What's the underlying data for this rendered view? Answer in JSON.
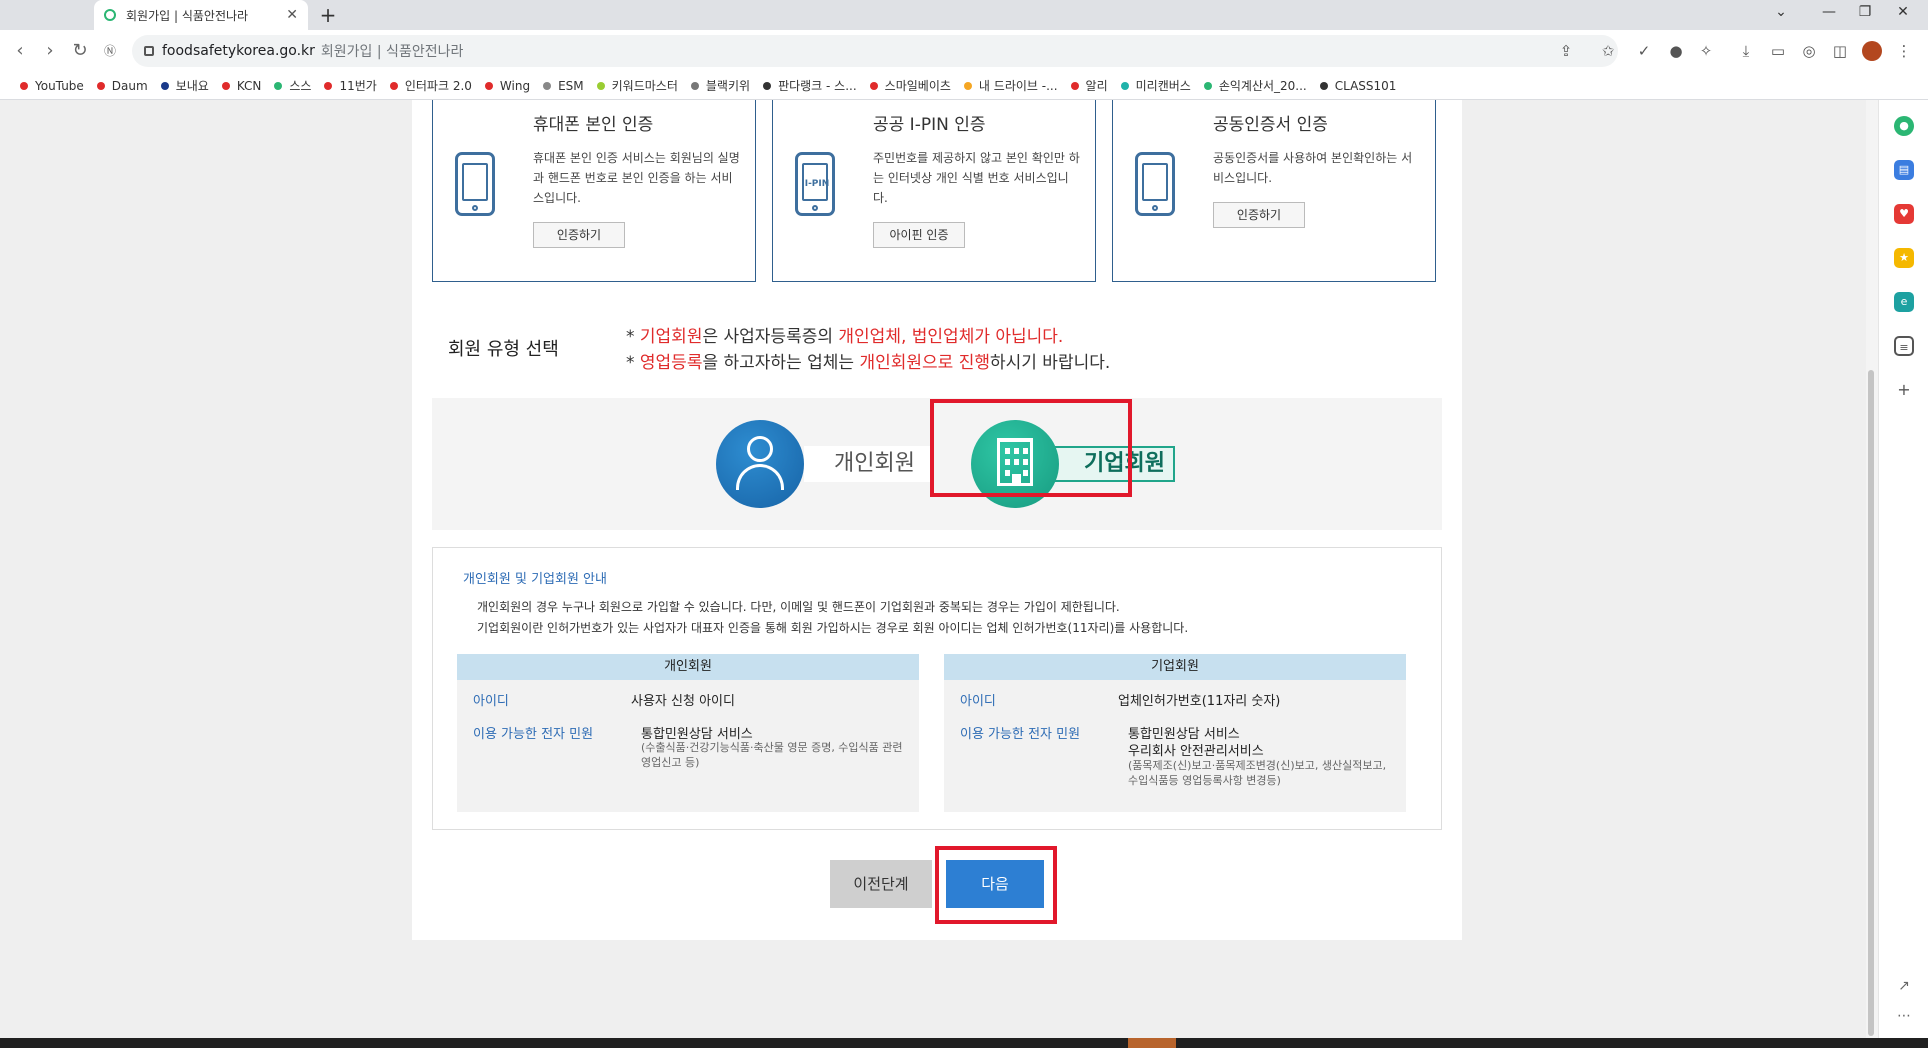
{
  "browser": {
    "tab_title": "회원가입 | 식품안전나라",
    "tab_close": "✕",
    "new_tab": "+",
    "window_controls": [
      "⌄",
      "—",
      "❐",
      "✕"
    ],
    "url_domain": "foodsafetykorea.go.kr",
    "url_path": "회원가입 | 식품안전나라",
    "bookmarks": [
      {
        "label": "YouTube",
        "color": "#e02b2b"
      },
      {
        "label": "Daum",
        "color": "#e02b2b"
      },
      {
        "label": "보내요",
        "color": "#1a3a8a"
      },
      {
        "label": "KCN",
        "color": "#e02b2b"
      },
      {
        "label": "스스",
        "color": "#2bb673"
      },
      {
        "label": "11번가",
        "color": "#e02b2b"
      },
      {
        "label": "인터파크 2.0",
        "color": "#e02b2b"
      },
      {
        "label": "Wing",
        "color": "#e02b2b"
      },
      {
        "label": "ESM",
        "color": "#888888"
      },
      {
        "label": "키워드마스터",
        "color": "#9acd32"
      },
      {
        "label": "블랙키위",
        "color": "#777777"
      },
      {
        "label": "판다랭크 - 스...",
        "color": "#333333"
      },
      {
        "label": "스마일베이츠",
        "color": "#e02b2b"
      },
      {
        "label": "내 드라이브 -...",
        "color": "#f5a623"
      },
      {
        "label": "알리",
        "color": "#e02b2b"
      },
      {
        "label": "미리캔버스",
        "color": "#20b2aa"
      },
      {
        "label": "손익계산서_20...",
        "color": "#2bb673"
      },
      {
        "label": "CLASS101",
        "color": "#333333"
      }
    ]
  },
  "auth": [
    {
      "title": "휴대폰 본인 인증",
      "desc": "휴대폰 본인 인증 서비스는 회원님의 실명과 핸드폰 번호로 본인 인증을 하는 서비스입니다.",
      "button": "인증하기"
    },
    {
      "title": "공공 I-PIN 인증",
      "desc": "주민번호를 제공하지 않고 본인 확인만 하는 인터넷상 개인 식별 번호 서비스입니다.",
      "button": "아이핀 인증",
      "icon_label": "I-PIN"
    },
    {
      "title": "공동인증서 인증",
      "desc": "공동인증서를 사용하여 본인확인하는 서비스입니다.",
      "button": "인증하기"
    }
  ],
  "member_type": {
    "label": "회원 유형 선택",
    "notice1": {
      "prefix": "* ",
      "red1": "기업회원",
      "mid": "은 사업자등록증의 ",
      "red2": "개인업체, 법인업체가 아닙니다."
    },
    "notice2": {
      "prefix": "* ",
      "red1": "영업등록",
      "mid": "을 하고자하는 업체는 ",
      "red2": "개인회원으로 진행",
      "suffix": "하시기 바랍니다."
    },
    "personal": "개인회원",
    "company": "기업회원"
  },
  "info": {
    "title": "개인회원 및 기업회원 안내",
    "line1": "개인회원의 경우 누구나 회원으로 가입할 수 있습니다. 다만, 이메일 및 핸드폰이 기업회원과 중복되는 경우는 가입이 제한됩니다.",
    "line2": "기업회원이란 인허가번호가 있는 사업자가 대표자 인증을 통해 회원 가입하시는 경우로 회원 아이디는 업체 인허가번호(11자리)를 사용합니다.",
    "personal": {
      "header": "개인회원",
      "id_key": "아이디",
      "id_val": "사용자 신청 아이디",
      "svc_key": "이용 가능한 전자 민원",
      "svc_val": "통합민원상담 서비스",
      "svc_sub": "(수출식품·건강기능식품·축산물 영문 증명, 수입식품 관련 영업신고 등)"
    },
    "company": {
      "header": "기업회원",
      "id_key": "아이디",
      "id_val": "업체인허가번호(11자리 숫자)",
      "svc_key": "이용 가능한 전자 민원",
      "svc_val": "통합민원상담 서비스",
      "svc_val2": "우리회사 안전관리서비스",
      "svc_sub": "(품목제조(신)보고·품목제조변경(신)보고, 생산실적보고, 수입식품등 영업등록사항 변경등)"
    }
  },
  "buttons": {
    "prev": "이전단계",
    "next": "다음"
  },
  "colors": {
    "accent_red": "#e1182b",
    "blue_button": "#2d7fd3",
    "teal": "#20a58a"
  }
}
